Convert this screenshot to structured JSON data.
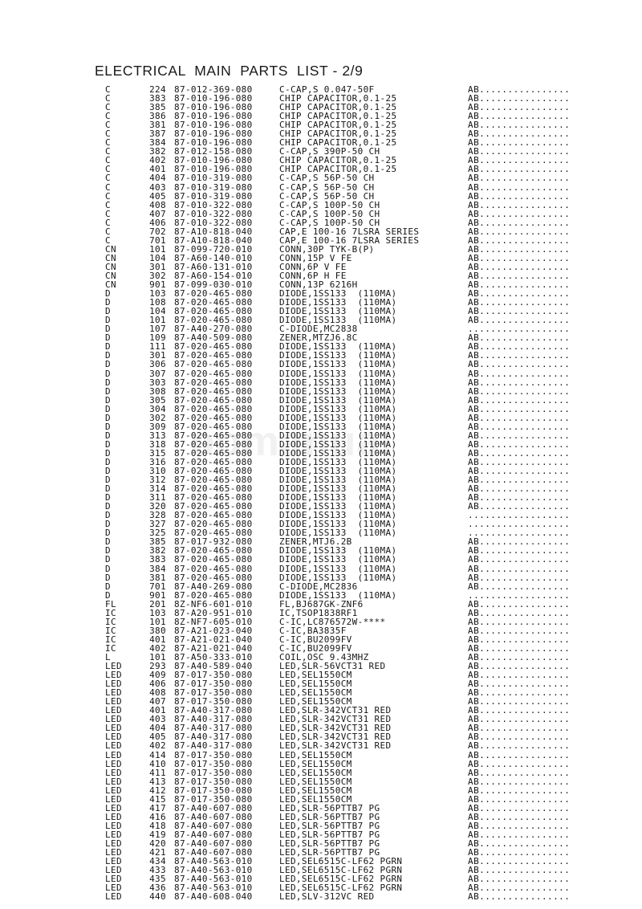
{
  "document": {
    "title": "ELECTRICAL  MAIN  PARTS  LIST - 2/9",
    "watermark": "oomanual"
  },
  "table": {
    "columns": [
      "ref",
      "number",
      "part_no",
      "description",
      "marking"
    ],
    "rows": [
      [
        "C",
        "224",
        "87-012-369-080",
        "C-CAP,S 0.047-50F",
        "AB................"
      ],
      [
        "C",
        "383",
        "87-010-196-080",
        "CHIP CAPACITOR,0.1-25",
        "AB................"
      ],
      [
        "C",
        "385",
        "87-010-196-080",
        "CHIP CAPACITOR,0.1-25",
        "AB................"
      ],
      [
        "C",
        "386",
        "87-010-196-080",
        "CHIP CAPACITOR,0.1-25",
        "AB................"
      ],
      [
        "C",
        "381",
        "87-010-196-080",
        "CHIP CAPACITOR,0.1-25",
        "AB................"
      ],
      [
        "C",
        "387",
        "87-010-196-080",
        "CHIP CAPACITOR,0.1-25",
        "AB................"
      ],
      [
        "C",
        "384",
        "87-010-196-080",
        "CHIP CAPACITOR,0.1-25",
        "AB................"
      ],
      [
        "C",
        "382",
        "87-012-158-080",
        "C-CAP,S 390P-50 CH",
        "AB................"
      ],
      [
        "C",
        "402",
        "87-010-196-080",
        "CHIP CAPACITOR,0.1-25",
        "AB................"
      ],
      [
        "C",
        "401",
        "87-010-196-080",
        "CHIP CAPACITOR,0.1-25",
        "AB................"
      ],
      [
        "C",
        "404",
        "87-010-319-080",
        "C-CAP,S 56P-50 CH",
        "AB................"
      ],
      [
        "C",
        "403",
        "87-010-319-080",
        "C-CAP,S 56P-50 CH",
        "AB................"
      ],
      [
        "C",
        "405",
        "87-010-319-080",
        "C-CAP,S 56P-50 CH",
        "AB................"
      ],
      [
        "C",
        "408",
        "87-010-322-080",
        "C-CAP,S 100P-50 CH",
        "AB................"
      ],
      [
        "C",
        "407",
        "87-010-322-080",
        "C-CAP,S 100P-50 CH",
        "AB................"
      ],
      [
        "C",
        "406",
        "87-010-322-080",
        "C-CAP,S 100P-50 CH",
        "AB................"
      ],
      [
        "C",
        "702",
        "87-A10-818-040",
        "CAP,E 100-16 7LSRA SERIES",
        "AB................"
      ],
      [
        "C",
        "701",
        "87-A10-818-040",
        "CAP,E 100-16 7LSRA SERIES",
        "AB................"
      ],
      [
        "CN",
        "101",
        "87-099-720-010",
        "CONN,30P TYK-B(P)",
        "AB................"
      ],
      [
        "CN",
        "104",
        "87-A60-140-010",
        "CONN,15P V FE",
        "AB................"
      ],
      [
        "CN",
        "301",
        "87-A60-131-010",
        "CONN,6P V FE",
        "AB................"
      ],
      [
        "CN",
        "302",
        "87-A60-154-010",
        "CONN,6P H FE",
        "AB................"
      ],
      [
        "CN",
        "901",
        "87-099-030-010",
        "CONN,13P 6216H",
        "AB................"
      ],
      [
        "D",
        "103",
        "87-020-465-080",
        "DIODE,1SS133  (110MA)",
        "AB................"
      ],
      [
        "D",
        "108",
        "87-020-465-080",
        "DIODE,1SS133  (110MA)",
        "AB................"
      ],
      [
        "D",
        "104",
        "87-020-465-080",
        "DIODE,1SS133  (110MA)",
        "AB................"
      ],
      [
        "D",
        "101",
        "87-020-465-080",
        "DIODE,1SS133  (110MA)",
        "AB................"
      ],
      [
        "D",
        "107",
        "87-A40-270-080",
        "C-DIODE,MC2838",
        ".................."
      ],
      [
        "D",
        "109",
        "87-A40-509-080",
        "ZENER,MTZJ6.8C",
        "AB................"
      ],
      [
        "D",
        "111",
        "87-020-465-080",
        "DIODE,1SS133  (110MA)",
        "AB................"
      ],
      [
        "D",
        "301",
        "87-020-465-080",
        "DIODE,1SS133  (110MA)",
        "AB................"
      ],
      [
        "D",
        "306",
        "87-020-465-080",
        "DIODE,1SS133  (110MA)",
        "AB................"
      ],
      [
        "D",
        "307",
        "87-020-465-080",
        "DIODE,1SS133  (110MA)",
        "AB................"
      ],
      [
        "D",
        "303",
        "87-020-465-080",
        "DIODE,1SS133  (110MA)",
        "AB................"
      ],
      [
        "D",
        "308",
        "87-020-465-080",
        "DIODE,1SS133  (110MA)",
        "AB................"
      ],
      [
        "D",
        "305",
        "87-020-465-080",
        "DIODE,1SS133  (110MA)",
        "AB................"
      ],
      [
        "D",
        "304",
        "87-020-465-080",
        "DIODE,1SS133  (110MA)",
        "AB................"
      ],
      [
        "D",
        "302",
        "87-020-465-080",
        "DIODE,1SS133  (110MA)",
        "AB................"
      ],
      [
        "D",
        "309",
        "87-020-465-080",
        "DIODE,1SS133  (110MA)",
        "AB................"
      ],
      [
        "D",
        "313",
        "87-020-465-080",
        "DIODE,1SS133  (110MA)",
        "AB................"
      ],
      [
        "D",
        "318",
        "87-020-465-080",
        "DIODE,1SS133  (110MA)",
        "AB................"
      ],
      [
        "D",
        "315",
        "87-020-465-080",
        "DIODE,1SS133  (110MA)",
        "AB................"
      ],
      [
        "D",
        "316",
        "87-020-465-080",
        "DIODE,1SS133  (110MA)",
        "AB................"
      ],
      [
        "D",
        "310",
        "87-020-465-080",
        "DIODE,1SS133  (110MA)",
        "AB................"
      ],
      [
        "D",
        "312",
        "87-020-465-080",
        "DIODE,1SS133  (110MA)",
        "AB................"
      ],
      [
        "D",
        "314",
        "87-020-465-080",
        "DIODE,1SS133  (110MA)",
        "AB................"
      ],
      [
        "D",
        "311",
        "87-020-465-080",
        "DIODE,1SS133  (110MA)",
        "AB................"
      ],
      [
        "D",
        "320",
        "87-020-465-080",
        "DIODE,1SS133  (110MA)",
        "AB................"
      ],
      [
        "D",
        "328",
        "87-020-465-080",
        "DIODE,1SS133  (110MA)",
        ".................."
      ],
      [
        "D",
        "327",
        "87-020-465-080",
        "DIODE,1SS133  (110MA)",
        ".................."
      ],
      [
        "D",
        "325",
        "87-020-465-080",
        "DIODE,1SS133  (110MA)",
        ".................."
      ],
      [
        "D",
        "385",
        "87-017-932-080",
        "ZENER,MTJ6.2B",
        "AB................"
      ],
      [
        "D",
        "382",
        "87-020-465-080",
        "DIODE,1SS133  (110MA)",
        "AB................"
      ],
      [
        "D",
        "383",
        "87-020-465-080",
        "DIODE,1SS133  (110MA)",
        "AB................"
      ],
      [
        "D",
        "384",
        "87-020-465-080",
        "DIODE,1SS133  (110MA)",
        "AB................"
      ],
      [
        "D",
        "381",
        "87-020-465-080",
        "DIODE,1SS133  (110MA)",
        "AB................"
      ],
      [
        "D",
        "701",
        "87-A40-269-080",
        "C-DIODE,MC2836",
        "AB................"
      ],
      [
        "D",
        "901",
        "87-020-465-080",
        "DIODE,1SS133  (110MA)",
        ".................."
      ],
      [
        "FL",
        "201",
        "8Z-NF6-601-010",
        "FL,BJ687GK-ZNF6",
        "AB................"
      ],
      [
        "IC",
        "103",
        "87-A20-951-010",
        "IC,TSOP1838RF1",
        "AB................"
      ],
      [
        "IC",
        "101",
        "8Z-NF7-605-010",
        "C-IC,LC876572W-****",
        "AB................"
      ],
      [
        "IC",
        "380",
        "87-A21-023-040",
        "C-IC,BA3835F",
        "AB................"
      ],
      [
        "IC",
        "401",
        "87-A21-021-040",
        "C-IC,BU2099FV",
        "AB................"
      ],
      [
        "IC",
        "402",
        "87-A21-021-040",
        "C-IC,BU2099FV",
        "AB................"
      ],
      [
        "L",
        "101",
        "87-A50-333-010",
        "COIL,OSC 9.43MHZ",
        "AB................"
      ],
      [
        "LED",
        "293",
        "87-A40-589-040",
        "LED,SLR-56VCT31 RED",
        "AB................"
      ],
      [
        "LED",
        "409",
        "87-017-350-080",
        "LED,SEL1550CM",
        "AB................"
      ],
      [
        "LED",
        "406",
        "87-017-350-080",
        "LED,SEL1550CM",
        "AB................"
      ],
      [
        "LED",
        "408",
        "87-017-350-080",
        "LED,SEL1550CM",
        "AB................"
      ],
      [
        "LED",
        "407",
        "87-017-350-080",
        "LED,SEL1550CM",
        "AB................"
      ],
      [
        "LED",
        "401",
        "87-A40-317-080",
        "LED,SLR-342VCT31 RED",
        "AB................"
      ],
      [
        "LED",
        "403",
        "87-A40-317-080",
        "LED,SLR-342VCT31 RED",
        "AB................"
      ],
      [
        "LED",
        "404",
        "87-A40-317-080",
        "LED,SLR-342VCT31 RED",
        "AB................"
      ],
      [
        "LED",
        "405",
        "87-A40-317-080",
        "LED,SLR-342VCT31 RED",
        "AB................"
      ],
      [
        "LED",
        "402",
        "87-A40-317-080",
        "LED,SLR-342VCT31 RED",
        "AB................"
      ],
      [
        "LED",
        "414",
        "87-017-350-080",
        "LED,SEL1550CM",
        "AB................"
      ],
      [
        "LED",
        "410",
        "87-017-350-080",
        "LED,SEL1550CM",
        "AB................"
      ],
      [
        "LED",
        "411",
        "87-017-350-080",
        "LED,SEL1550CM",
        "AB................"
      ],
      [
        "LED",
        "413",
        "87-017-350-080",
        "LED,SEL1550CM",
        "AB................"
      ],
      [
        "LED",
        "412",
        "87-017-350-080",
        "LED,SEL1550CM",
        "AB................"
      ],
      [
        "LED",
        "415",
        "87-017-350-080",
        "LED,SEL1550CM",
        "AB................"
      ],
      [
        "LED",
        "417",
        "87-A40-607-080",
        "LED,SLR-56PTTB7 PG",
        "AB................"
      ],
      [
        "LED",
        "416",
        "87-A40-607-080",
        "LED,SLR-56PTTB7 PG",
        "AB................"
      ],
      [
        "LED",
        "418",
        "87-A40-607-080",
        "LED,SLR-56PTTB7 PG",
        "AB................"
      ],
      [
        "LED",
        "419",
        "87-A40-607-080",
        "LED,SLR-56PTTB7 PG",
        "AB................"
      ],
      [
        "LED",
        "420",
        "87-A40-607-080",
        "LED,SLR-56PTTB7 PG",
        "AB................"
      ],
      [
        "LED",
        "421",
        "87-A40-607-080",
        "LED,SLR-56PTTB7 PG",
        "AB................"
      ],
      [
        "LED",
        "434",
        "87-A40-563-010",
        "LED,SEL6515C-LF62 PGRN",
        "AB................"
      ],
      [
        "LED",
        "433",
        "87-A40-563-010",
        "LED,SEL6515C-LF62 PGRN",
        "AB................"
      ],
      [
        "LED",
        "435",
        "87-A40-563-010",
        "LED,SEL6515C-LF62 PGRN",
        "AB................"
      ],
      [
        "LED",
        "436",
        "87-A40-563-010",
        "LED,SEL6515C-LF62 PGRN",
        "AB................"
      ],
      [
        "LED",
        "440",
        "87-A40-608-040",
        "LED,SLV-312VC RED",
        "AB................"
      ]
    ]
  }
}
